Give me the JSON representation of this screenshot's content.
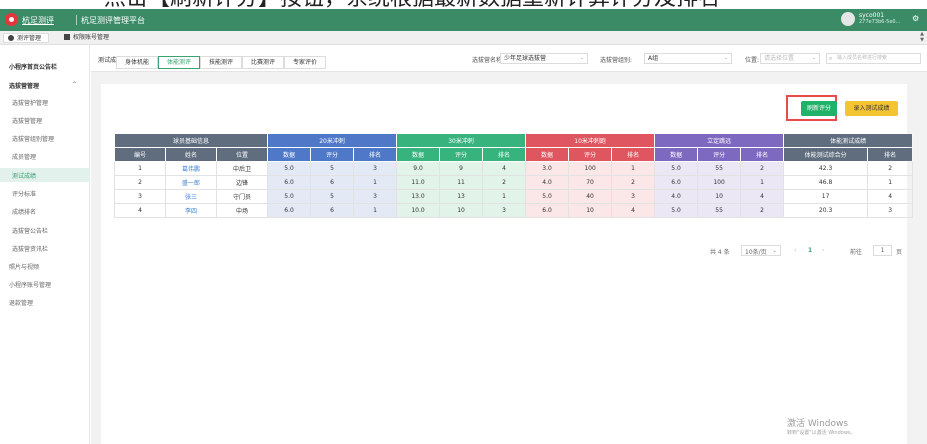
{
  "caption": "点击【刷新评分】按钮，系统根据最新数据重新计算评分及排名",
  "topbar": {
    "brand": "杭足测评",
    "platform": "杭足测评管理平台",
    "user_name": "syco001",
    "user_sub": "277e73b6-5e0...",
    "settings_icon": "gear-icon"
  },
  "tabs": [
    {
      "label": "测评管理",
      "icon": "circle-icon"
    },
    {
      "label": "权限账号管理",
      "icon": "square-icon"
    }
  ],
  "sidebar": {
    "notice": "小程序首页公告栏",
    "group": "选拔营管理",
    "items": [
      "选拔营护管理",
      "选拔营管理",
      "选拔营组别管理",
      "成员管理",
      "测试成绩",
      "评分标准",
      "成绩排名",
      "选拔营公告栏",
      "选拔营资讯栏"
    ],
    "others": [
      "照片与视频",
      "小程序账号管理",
      "退款管理"
    ]
  },
  "header": {
    "title": "测试成绩",
    "camp_label": "选拔营名称:",
    "camp_value": "少年足球选拔营",
    "group_label": "选拔营组别:",
    "group_value": "A组",
    "position_label": "位置:",
    "position_placeholder": "请选择位置",
    "search_placeholder": "输入成员名称进行搜索"
  },
  "filter_tabs": [
    "身体机能",
    "体能测评",
    "技能测评",
    "比赛测评",
    "专家评价"
  ],
  "buttons": {
    "refresh": "刷新评分",
    "enter": "录入测试成绩"
  },
  "table": {
    "groups": [
      "球员基础信息",
      "20米冲刺",
      "30米冲刺",
      "10米冲刺跑",
      "立定跳远",
      "体能测试成绩"
    ],
    "subheads": [
      "编号",
      "姓名",
      "位置",
      "数据",
      "评分",
      "排名",
      "数据",
      "评分",
      "排名",
      "数据",
      "评分",
      "排名",
      "数据",
      "评分",
      "排名",
      "体能测试综合分",
      "排名"
    ],
    "rows": [
      [
        "1",
        "葛伟鹏",
        "中后卫",
        "5.0",
        "5",
        "3",
        "9.0",
        "9",
        "4",
        "3.0",
        "100",
        "1",
        "5.0",
        "55",
        "2",
        "42.3",
        "2"
      ],
      [
        "2",
        "盛一郎",
        "边锋",
        "6.0",
        "6",
        "1",
        "11.0",
        "11",
        "2",
        "4.0",
        "70",
        "2",
        "6.0",
        "100",
        "1",
        "46.8",
        "1"
      ],
      [
        "3",
        "张三",
        "守门员",
        "5.0",
        "5",
        "3",
        "13.0",
        "13",
        "1",
        "5.0",
        "40",
        "3",
        "4.0",
        "10",
        "4",
        "17",
        "4"
      ],
      [
        "4",
        "李四",
        "中场",
        "6.0",
        "6",
        "1",
        "10.0",
        "10",
        "3",
        "6.0",
        "10",
        "4",
        "5.0",
        "55",
        "2",
        "20.3",
        "3"
      ]
    ]
  },
  "pager": {
    "total": "共 4 条",
    "size": "10条/页",
    "prev": "‹",
    "page": "1",
    "next": "›",
    "goto": "前往",
    "input": "1",
    "unit": "页"
  },
  "watermark": {
    "line1": "激活 Windows",
    "line2": "转到\"设置\"以激活 Windows。"
  }
}
